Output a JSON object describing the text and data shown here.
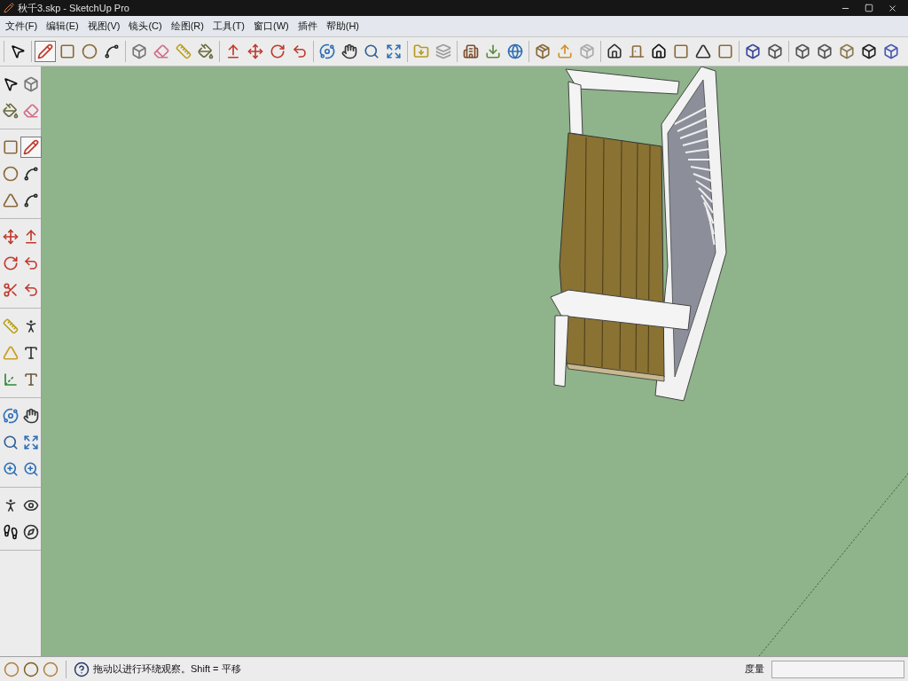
{
  "window": {
    "title": "秋千3.skp - SketchUp Pro"
  },
  "menu": [
    "文件(F)",
    "编辑(E)",
    "视图(V)",
    "镜头(C)",
    "绘图(R)",
    "工具(T)",
    "窗口(W)",
    "插件",
    "帮助(H)"
  ],
  "top_toolbar": {
    "groups": [
      {
        "tools": [
          {
            "selected": false
          }
        ]
      },
      {
        "tools": [
          {
            "selected": true
          },
          {
            "selected": false
          },
          {
            "selected": false
          },
          {
            "selected": false
          }
        ]
      },
      {
        "tools": [
          {
            "selected": false
          },
          {
            "selected": false
          },
          {
            "selected": false
          },
          {
            "selected": false
          }
        ]
      },
      {
        "tools": [
          {
            "selected": false
          },
          {
            "selected": false
          },
          {
            "selected": false
          },
          {
            "selected": false
          }
        ]
      },
      {
        "tools": [
          {
            "selected": false
          },
          {
            "selected": false
          },
          {
            "selected": false
          },
          {
            "selected": false
          }
        ]
      },
      {
        "tools": [
          {
            "selected": false
          },
          {
            "selected": false
          }
        ]
      },
      {
        "tools": [
          {
            "selected": false
          },
          {
            "selected": false
          },
          {
            "selected": false
          }
        ]
      },
      {
        "tools": [
          {
            "selected": false
          },
          {
            "selected": false
          },
          {
            "selected": false
          }
        ]
      },
      {
        "tools": [
          {
            "selected": false
          },
          {
            "selected": false
          },
          {
            "selected": false
          },
          {
            "selected": false
          },
          {
            "selected": false
          },
          {
            "selected": false
          }
        ]
      },
      {
        "tools": [
          {
            "selected": false
          },
          {
            "selected": false
          }
        ]
      },
      {
        "tools": [
          {
            "selected": false
          },
          {
            "selected": false
          },
          {
            "selected": false
          },
          {
            "selected": false
          },
          {
            "selected": false
          }
        ]
      }
    ]
  },
  "left_toolbar": {
    "groups": [
      {
        "tools": [
          {
            "selected": false
          },
          {
            "selected": false
          },
          {
            "selected": false
          },
          {
            "selected": false
          }
        ]
      },
      {
        "tools": [
          {
            "selected": false
          },
          {
            "selected": true
          },
          {
            "selected": false
          },
          {
            "selected": false
          },
          {
            "selected": false
          },
          {
            "selected": false
          }
        ]
      },
      {
        "tools": [
          {
            "selected": false
          },
          {
            "selected": false
          },
          {
            "selected": false
          },
          {
            "selected": false
          },
          {
            "selected": false
          },
          {
            "selected": false
          }
        ]
      },
      {
        "tools": [
          {
            "selected": false
          },
          {
            "selected": false
          },
          {
            "selected": false
          },
          {
            "selected": false
          },
          {
            "selected": false
          },
          {
            "selected": false
          }
        ]
      },
      {
        "tools": [
          {
            "selected": false
          },
          {
            "selected": false
          },
          {
            "selected": false
          },
          {
            "selected": false
          },
          {
            "selected": false
          },
          {
            "selected": false
          }
        ]
      },
      {
        "tools": [
          {
            "selected": false
          },
          {
            "selected": false
          },
          {
            "selected": false
          },
          {
            "selected": false
          }
        ]
      }
    ]
  },
  "status_bar": {
    "hint": "拖动以进行环绕观察。Shift = 平移",
    "measure_label": "度量"
  }
}
